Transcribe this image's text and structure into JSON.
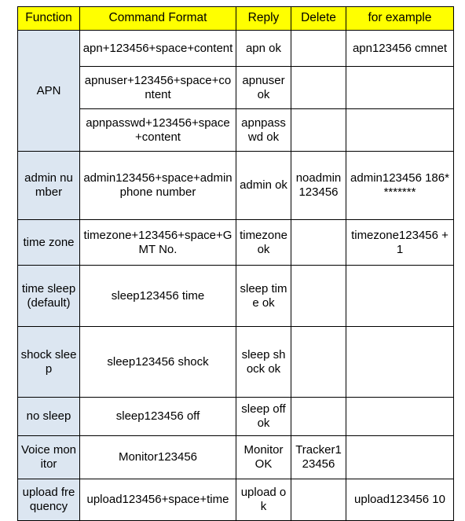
{
  "table": {
    "headers": [
      "Function",
      "Command Format",
      "Reply",
      "Delete",
      "for example"
    ],
    "rows": [
      {
        "function": "APN",
        "function_rowspan": 3,
        "cells": [
          {
            "command": "apn+123456+space+content",
            "reply": "apn ok",
            "delete": "",
            "example": "apn123456 cmnet"
          },
          {
            "command": "apnuser+123456+space+content",
            "reply": "apnuser ok",
            "delete": "",
            "example": ""
          },
          {
            "command": "apnpasswd+123456+space+content",
            "reply": "apnpasswd ok",
            "delete": "",
            "example": ""
          }
        ]
      },
      {
        "function": "admin number",
        "function_rowspan": 1,
        "cells": [
          {
            "command": "admin123456+space+admin phone number",
            "reply": "admin ok",
            "delete": "noadmin123456",
            "example": "admin123456 186********"
          }
        ]
      },
      {
        "function": "time zone",
        "function_rowspan": 1,
        "cells": [
          {
            "command": "timezone+123456+space+GMT No.",
            "reply": "timezone ok",
            "delete": "",
            "example": "timezone123456 +1"
          }
        ]
      },
      {
        "function": "time sleep(default)",
        "function_rowspan": 1,
        "cells": [
          {
            "command": "sleep123456 time",
            "reply": "sleep time ok",
            "delete": "",
            "example": ""
          }
        ]
      },
      {
        "function": "shock sleep",
        "function_rowspan": 1,
        "cells": [
          {
            "command": "sleep123456 shock",
            "reply": "sleep shock ok",
            "delete": "",
            "example": ""
          }
        ]
      },
      {
        "function": "no sleep",
        "function_rowspan": 1,
        "cells": [
          {
            "command": "sleep123456 off",
            "reply": "sleep off ok",
            "delete": "",
            "example": ""
          }
        ]
      },
      {
        "function": "Voice monitor",
        "function_rowspan": 1,
        "cells": [
          {
            "command": "Monitor123456",
            "reply": "Monitor OK",
            "delete": "Tracker123456",
            "example": ""
          }
        ]
      },
      {
        "function": "upload frequency",
        "function_rowspan": 1,
        "cells": [
          {
            "command": "upload123456+space+time",
            "reply": "upload ok",
            "delete": "",
            "example": "upload123456 10"
          }
        ]
      }
    ]
  },
  "colors": {
    "header_background": "#ffff00",
    "function_column_background": "#dce6f1",
    "cell_background": "#ffffff",
    "border": "#000000",
    "text": "#000000"
  }
}
